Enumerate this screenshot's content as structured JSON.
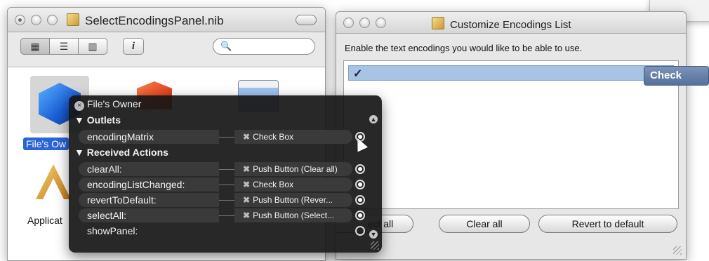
{
  "nib_window": {
    "title": "SelectEncodingsPanel.nib",
    "search_icon": "🔍",
    "view_modes": [
      "icon-view-icon",
      "list-view-icon",
      "column-view-icon"
    ],
    "info_label": "i",
    "items": [
      {
        "label": "File's Ow",
        "icon": "cube-icon",
        "selected": true
      },
      {
        "label": "Applicat",
        "icon": "application-icon",
        "selected": false
      }
    ]
  },
  "encodings_window": {
    "title": "Customize Encodings List",
    "prompt": "Enable the text encodings you would like to be able to use.",
    "check_mark": "✓",
    "buttons": {
      "select_all": "ect all",
      "clear_all": "Clear all",
      "revert": "Revert to default"
    }
  },
  "tooltip": {
    "label": "Check Box"
  },
  "connections_panel": {
    "title": "File's Owner",
    "close_symbol": "×",
    "outlets_header": "▼ Outlets",
    "actions_header": "▼ Received Actions",
    "outlets": [
      {
        "name": "encodingMatrix",
        "target": "Check Box",
        "connected": true
      }
    ],
    "actions": [
      {
        "name": "clearAll:",
        "target": "Push Button (Clear all)",
        "connected": true
      },
      {
        "name": "encodingListChanged:",
        "target": "Check Box",
        "connected": true
      },
      {
        "name": "revertToDefault:",
        "target": "Push Button (Rever...",
        "connected": true
      },
      {
        "name": "selectAll:",
        "target": "Push Button (Select...",
        "connected": true
      },
      {
        "name": "showPanel:",
        "target": "",
        "connected": false
      }
    ],
    "remove_symbol": "✖"
  },
  "colors": {
    "hud_bg": "#161616",
    "selection": "#2a64d6",
    "row_highlight": "#a8c4e4"
  }
}
